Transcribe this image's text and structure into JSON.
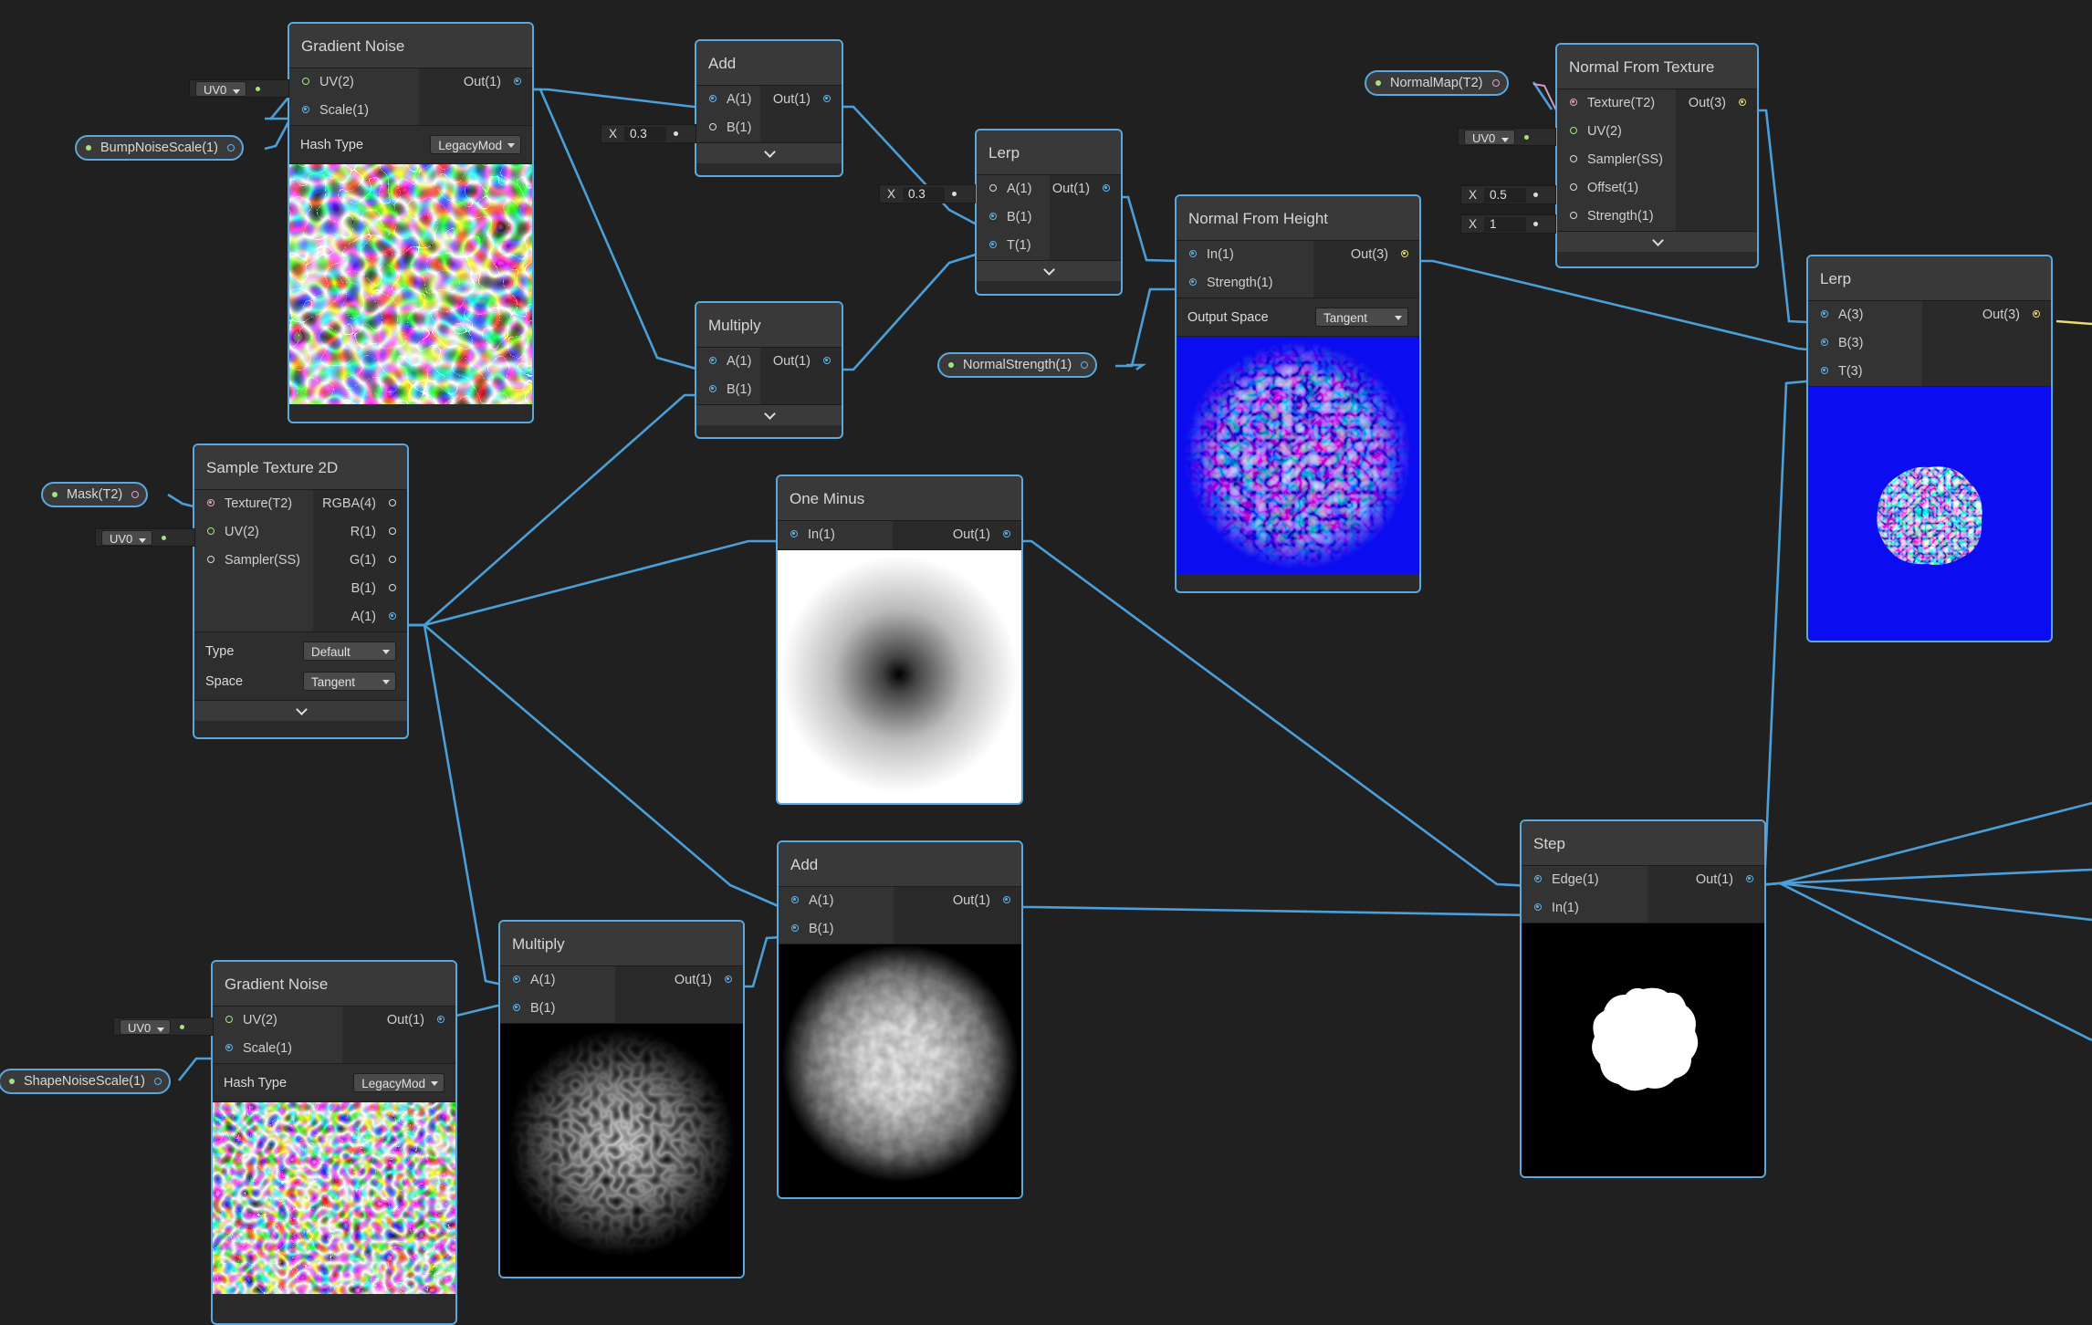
{
  "nodes": {
    "gradient_noise_1": {
      "title": "Gradient Noise",
      "inputs": [
        "UV(2)",
        "Scale(1)"
      ],
      "output": "Out(1)",
      "hash_label": "Hash Type",
      "hash_value": "LegacyMod"
    },
    "add_1": {
      "title": "Add",
      "inputs": [
        "A(1)",
        "B(1)"
      ],
      "output": "Out(1)"
    },
    "multiply_1": {
      "title": "Multiply",
      "inputs": [
        "A(1)",
        "B(1)"
      ],
      "output": "Out(1)"
    },
    "lerp_1": {
      "title": "Lerp",
      "inputs": [
        "A(1)",
        "B(1)",
        "T(1)"
      ],
      "output": "Out(1)"
    },
    "normal_from_height": {
      "title": "Normal From Height",
      "inputs": [
        "In(1)",
        "Strength(1)"
      ],
      "output": "Out(3)",
      "space_label": "Output Space",
      "space_value": "Tangent"
    },
    "normal_from_texture": {
      "title": "Normal From Texture",
      "inputs": [
        "Texture(T2)",
        "UV(2)",
        "Sampler(SS)",
        "Offset(1)",
        "Strength(1)"
      ],
      "output": "Out(3)"
    },
    "lerp_2": {
      "title": "Lerp",
      "inputs": [
        "A(3)",
        "B(3)",
        "T(3)"
      ],
      "output": "Out(3)"
    },
    "sample_texture": {
      "title": "Sample Texture 2D",
      "inputs": [
        "Texture(T2)",
        "UV(2)",
        "Sampler(SS)"
      ],
      "outputs": [
        "RGBA(4)",
        "R(1)",
        "G(1)",
        "B(1)",
        "A(1)"
      ],
      "type_label": "Type",
      "type_value": "Default",
      "space_label": "Space",
      "space_value": "Tangent"
    },
    "one_minus": {
      "title": "One Minus",
      "inputs": [
        "In(1)"
      ],
      "output": "Out(1)"
    },
    "add_2": {
      "title": "Add",
      "inputs": [
        "A(1)",
        "B(1)"
      ],
      "output": "Out(1)"
    },
    "multiply_2": {
      "title": "Multiply",
      "inputs": [
        "A(1)",
        "B(1)"
      ],
      "output": "Out(1)"
    },
    "gradient_noise_2": {
      "title": "Gradient Noise",
      "inputs": [
        "UV(2)",
        "Scale(1)"
      ],
      "output": "Out(1)",
      "hash_label": "Hash Type",
      "hash_value": "LegacyMod"
    },
    "step": {
      "title": "Step",
      "inputs": [
        "Edge(1)",
        "In(1)"
      ],
      "output": "Out(1)"
    }
  },
  "properties": {
    "bump_noise_scale": "BumpNoiseScale(1)",
    "normal_strength": "NormalStrength(1)",
    "normal_map": "NormalMap(T2)",
    "mask": "Mask(T2)",
    "shape_noise_scale": "ShapeNoiseScale(1)"
  },
  "inline_inputs": {
    "uv_value": "UV0",
    "x_label": "X",
    "add_b": "0.3",
    "lerp_a": "0.3",
    "offset": "0.5",
    "strength": "1"
  },
  "colors": {
    "canvas": "#202020",
    "node_border": "#5aa8de",
    "wire": "#4b9fd9",
    "preview_normal_blue": "#0c0cf0",
    "port_vector1": "#5fb2e8",
    "port_texture": "#e6a0c8",
    "port_uv": "#a6e37f",
    "port_vector3": "#e8dc72"
  }
}
